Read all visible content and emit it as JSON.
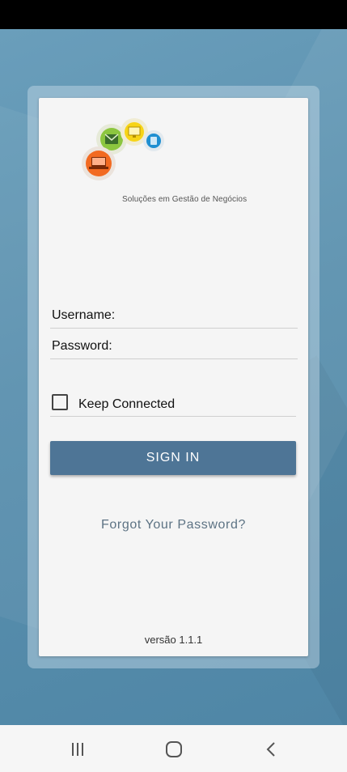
{
  "brand": {
    "tagline": "Soluções em Gestão de Negócios",
    "logo_icons": [
      "email-icon",
      "computer-icon",
      "phone-icon",
      "laptop-icon"
    ],
    "logo_colors": {
      "green": "#8cc63f",
      "yellow": "#f7d417",
      "blue": "#1f8fd1",
      "orange": "#f26a21"
    }
  },
  "form": {
    "username_label": "Username:",
    "username_value": "",
    "password_label": "Password:",
    "password_value": "",
    "keep_connected_label": "Keep Connected",
    "keep_connected_checked": false,
    "signin_label": "SIGN IN",
    "forgot_label": "Forgot Your Password?"
  },
  "footer": {
    "version": "versão 1.1.1"
  },
  "colors": {
    "accent": "#4e7596",
    "background": "#5a8eab",
    "link": "#5d7384"
  },
  "nav": {
    "recents_icon": "recents-icon",
    "home_icon": "home-icon",
    "back_icon": "back-icon"
  }
}
